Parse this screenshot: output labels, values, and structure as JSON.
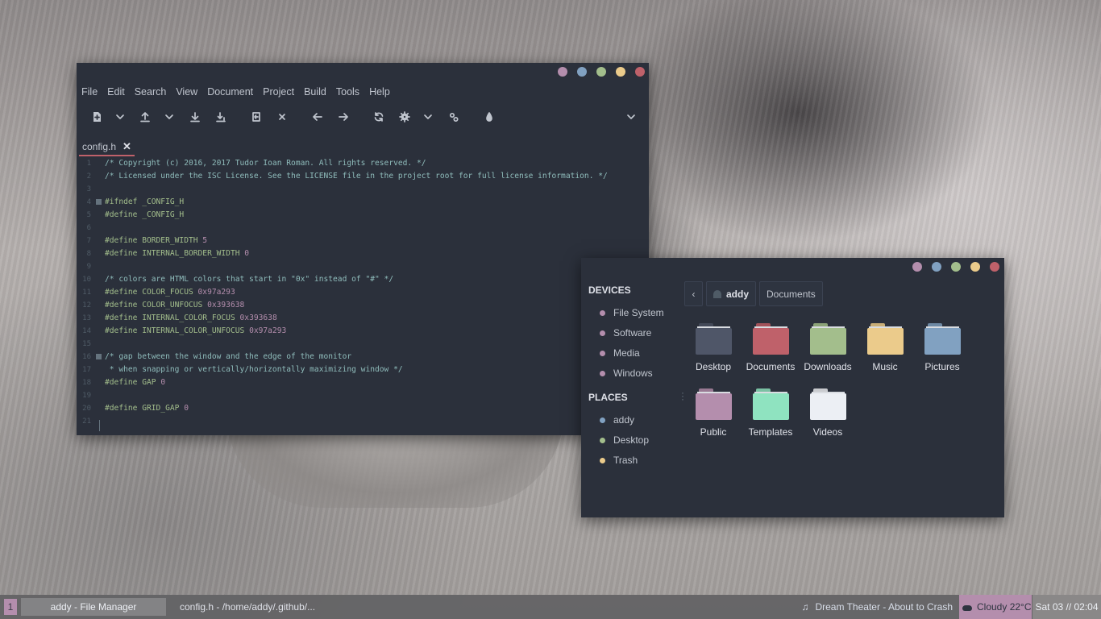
{
  "editor": {
    "window_buttons": [
      "#b48ead",
      "#81a1c1",
      "#a3be8c",
      "#ebcb8b",
      "#bf616a"
    ],
    "menu": [
      "File",
      "Edit",
      "Search",
      "View",
      "Document",
      "Project",
      "Build",
      "Tools",
      "Help"
    ],
    "toolbar_icons": [
      "new-file-icon",
      "dropdown-icon",
      "open-file-icon",
      "dropdown-icon",
      "save-icon",
      "save-all-icon",
      "revert-icon",
      "close-file-icon",
      "back-icon",
      "forward-icon",
      "reload-icon",
      "build-icon",
      "dropdown-icon",
      "execute-icon",
      "color-picker-icon",
      "toolbar-overflow-icon"
    ],
    "tab": {
      "label": "config.h",
      "close": "✕"
    },
    "lines": [
      {
        "n": "1",
        "segs": [
          [
            "/* Copyright (c) 2016, 2017 Tudor Ioan Roman. All rights reserved. */",
            "c-comment"
          ]
        ]
      },
      {
        "n": "2",
        "segs": [
          [
            "/* Licensed under the ISC License. See the LICENSE file in the project root for full license information. */",
            "c-comment"
          ]
        ]
      },
      {
        "n": "3",
        "segs": []
      },
      {
        "n": "4",
        "fold": true,
        "segs": [
          [
            "#ifndef _CONFIG_H",
            "c-pre"
          ]
        ]
      },
      {
        "n": "5",
        "segs": [
          [
            "#define _CONFIG_H",
            "c-pre"
          ]
        ]
      },
      {
        "n": "6",
        "segs": []
      },
      {
        "n": "7",
        "segs": [
          [
            "#define BORDER_WIDTH ",
            "c-pre"
          ],
          [
            "5",
            "c-num"
          ]
        ]
      },
      {
        "n": "8",
        "segs": [
          [
            "#define INTERNAL_BORDER_WIDTH ",
            "c-pre"
          ],
          [
            "0",
            "c-num"
          ]
        ]
      },
      {
        "n": "9",
        "segs": []
      },
      {
        "n": "10",
        "segs": [
          [
            "/* colors are HTML colors that start in \"0x\" instead of \"#\" */",
            "c-comment"
          ]
        ]
      },
      {
        "n": "11",
        "segs": [
          [
            "#define COLOR_FOCUS ",
            "c-pre"
          ],
          [
            "0x97a293",
            "c-num"
          ]
        ]
      },
      {
        "n": "12",
        "segs": [
          [
            "#define COLOR_UNFOCUS ",
            "c-pre"
          ],
          [
            "0x393638",
            "c-num"
          ]
        ]
      },
      {
        "n": "13",
        "segs": [
          [
            "#define INTERNAL_COLOR_FOCUS ",
            "c-pre"
          ],
          [
            "0x393638",
            "c-num"
          ]
        ]
      },
      {
        "n": "14",
        "segs": [
          [
            "#define INTERNAL_COLOR_UNFOCUS ",
            "c-pre"
          ],
          [
            "0x97a293",
            "c-num"
          ]
        ]
      },
      {
        "n": "15",
        "segs": []
      },
      {
        "n": "16",
        "fold": true,
        "segs": [
          [
            "/* gap between the window and the edge of the monitor",
            "c-comment"
          ]
        ]
      },
      {
        "n": "17",
        "segs": [
          [
            " * when snapping or vertically/horizontally maximizing window */",
            "c-comment"
          ]
        ]
      },
      {
        "n": "18",
        "segs": [
          [
            "#define GAP ",
            "c-pre"
          ],
          [
            "0",
            "c-num"
          ]
        ]
      },
      {
        "n": "19",
        "segs": []
      },
      {
        "n": "20",
        "segs": [
          [
            "#define GRID_GAP ",
            "c-pre"
          ],
          [
            "0",
            "c-num"
          ]
        ]
      },
      {
        "n": "21",
        "segs": []
      }
    ]
  },
  "file_manager": {
    "window_buttons": [
      "#b48ead",
      "#81a1c1",
      "#a3be8c",
      "#ebcb8b",
      "#bf616a"
    ],
    "devices_heading": "DEVICES",
    "devices": [
      {
        "label": "File System",
        "color": "#b48ead"
      },
      {
        "label": "Software",
        "color": "#b48ead"
      },
      {
        "label": "Media",
        "color": "#b48ead"
      },
      {
        "label": "Windows",
        "color": "#b48ead"
      }
    ],
    "places_heading": "PLACES",
    "places": [
      {
        "label": "addy",
        "color": "#81a1c1"
      },
      {
        "label": "Desktop",
        "color": "#a3be8c"
      },
      {
        "label": "Trash",
        "color": "#ebcb8b"
      }
    ],
    "path": {
      "back": "‹",
      "home": "addy",
      "current": "Documents"
    },
    "folders": [
      {
        "label": "Desktop",
        "color": "#4f5668"
      },
      {
        "label": "Documents",
        "color": "#bf616a"
      },
      {
        "label": "Downloads",
        "color": "#a3be8c"
      },
      {
        "label": "Music",
        "color": "#ebcb8b"
      },
      {
        "label": "Pictures",
        "color": "#81a1c1"
      },
      {
        "label": "Public",
        "color": "#b48ead"
      },
      {
        "label": "Templates",
        "color": "#8fe3c0"
      },
      {
        "label": "Videos",
        "color": "#eceff4"
      }
    ]
  },
  "taskbar": {
    "workspace": "1",
    "tasks": [
      "addy - File Manager",
      "config.h - /home/addy/.github/..."
    ],
    "music_icon": "♫",
    "music": "Dream Theater - About to Crash",
    "weather": "Cloudy 22°C",
    "clock": "Sat 03 // 02:04"
  }
}
